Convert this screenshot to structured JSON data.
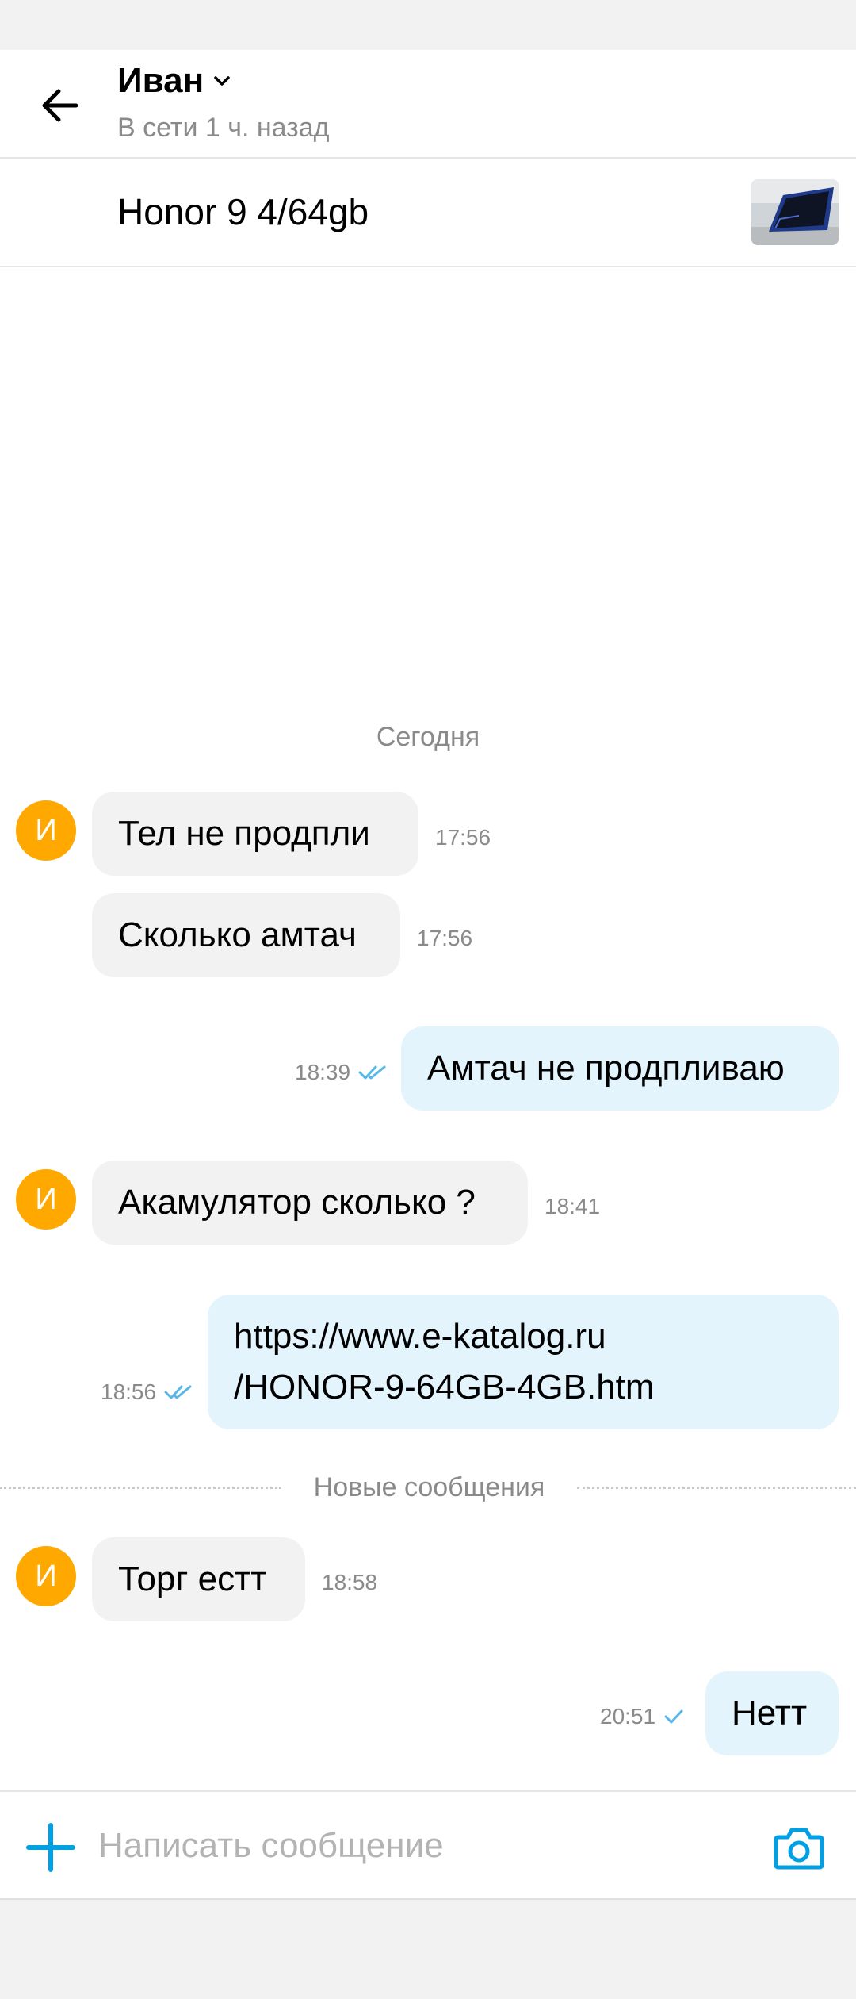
{
  "header": {
    "contact_name": "Иван",
    "status": "В сети 1 ч. назад"
  },
  "item": {
    "title": "Honor 9 4/64gb"
  },
  "chat": {
    "date_label": "Сегодня",
    "new_messages_label": "Новые сообщения",
    "avatar_letter": "И",
    "messages": [
      {
        "direction": "in",
        "text": "Тел не продпли",
        "time": "17:56"
      },
      {
        "direction": "in",
        "text": "Сколько амтач",
        "time": "17:56"
      },
      {
        "direction": "out",
        "text": "Амтач не продпливаю",
        "time": "18:39",
        "status": "read"
      },
      {
        "direction": "in",
        "text": "Акамулятор сколько ?",
        "time": "18:41"
      },
      {
        "direction": "out",
        "text_line1": "https://www.e-katalog.ru",
        "text_line2": "/HONOR-9-64GB-4GB.htm",
        "time": "18:56",
        "status": "read"
      },
      {
        "direction": "in",
        "text": "Торг естт",
        "time": "18:58"
      },
      {
        "direction": "out",
        "text": "Нетт",
        "time": "20:51",
        "status": "sent"
      }
    ]
  },
  "composer": {
    "placeholder": "Написать сообщение"
  },
  "colors": {
    "accent": "#00a0e4",
    "avatar": "#ffa800",
    "incoming_bubble": "#f2f2f2",
    "outgoing_bubble": "#e3f4fd"
  },
  "icons": [
    "back-arrow-icon",
    "chevron-down-icon",
    "plus-icon",
    "camera-icon",
    "double-check-icon",
    "single-check-icon"
  ]
}
